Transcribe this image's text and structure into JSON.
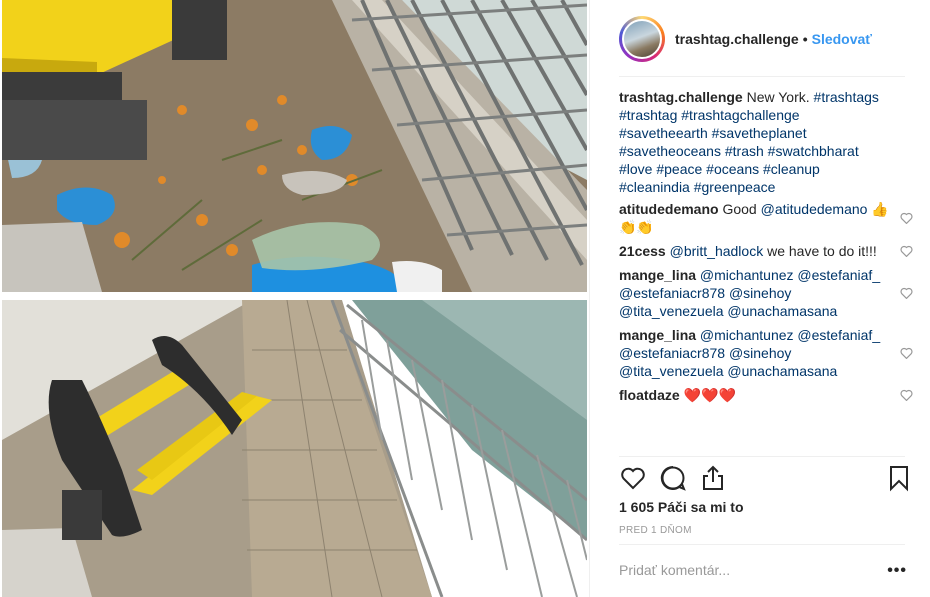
{
  "post": {
    "username": "trashtag.challenge",
    "follow_label": "Sledovať",
    "separator": "•",
    "likes_text": "1 605 Páči sa mi to",
    "date_text": "PRED 1 DŇOM",
    "add_comment_placeholder": "Pridať komentár...",
    "more_label": "•••"
  },
  "caption": {
    "user": "trashtag.challenge",
    "text": "New York.",
    "hashtags": "#trashtags #trashtag #trashtagchallenge #savetheearth #savetheplanet #savetheoceans #trash #swatchbharat #love #peace #oceans #cleanup #cleanindia #greenpeace"
  },
  "comments": [
    {
      "user": "atitudedemano",
      "text": "Good ",
      "mention": "@atitudedemano",
      "after": " 👍👏👏"
    },
    {
      "user": "21cess",
      "text": "",
      "mention": "@britt_hadlock",
      "after": " we have to do it!!!"
    },
    {
      "user": "mange_lina",
      "text": "",
      "mention": "@michantunez @estefaniaf_ @estefaniacr878 @sinehoy @tita_venezuela @unachamasana",
      "after": ""
    },
    {
      "user": "mange_lina",
      "text": "",
      "mention": "@michantunez @estefaniaf_ @estefaniacr878 @sinehoy @tita_venezuela @unachamasana",
      "after": ""
    },
    {
      "user": "floatdaze",
      "text": " ❤️❤️❤️",
      "mention": "",
      "after": ""
    }
  ],
  "icons": {
    "like": "heart-icon",
    "comment": "comment-icon",
    "share": "share-icon",
    "save": "bookmark-icon"
  },
  "colors": {
    "follow": "#3897f0",
    "mention": "#003569",
    "bench_yellow": "#f2d21a"
  }
}
